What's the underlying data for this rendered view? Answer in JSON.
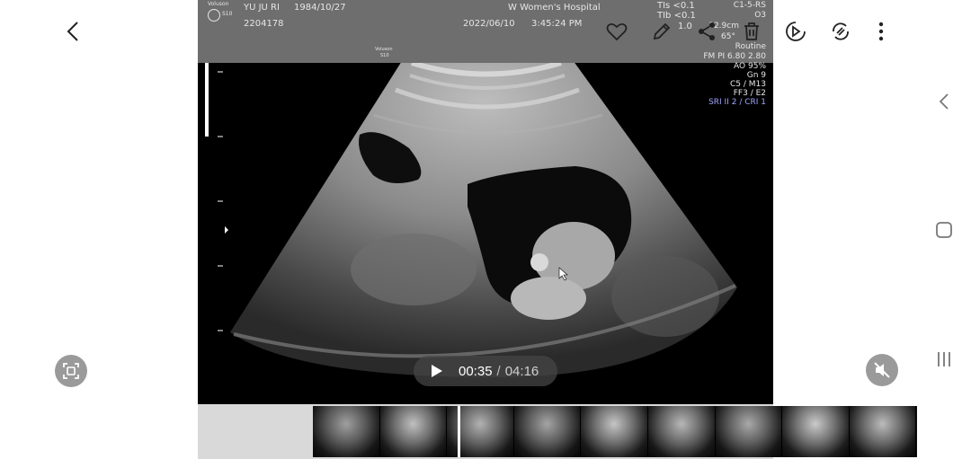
{
  "overlay": {
    "patient_name": "YU JU RI",
    "birth_date": "1984/10/27",
    "patient_id": "2204178",
    "hospital": "W Women's Hospital",
    "date": "2022/06/10",
    "time": "3:45:24 PM",
    "brand": "Voluson",
    "brand_model": "S10",
    "brand_logo": "GE",
    "tis_label": "TIs <0.1",
    "tib_label": "TIb <0.1",
    "mi_value": "1.0",
    "probe": "C1-5-RS",
    "preset": "O3",
    "depth": "12.9cm",
    "angle": "65°",
    "params": [
      "Routine",
      "FM PI 6.80    2.80",
      "AO 95%",
      "Gn  9",
      "C5 / M13",
      "FF3 / E2",
      "SRI II 2 / CRI 1"
    ]
  },
  "toolbar": {
    "back_icon": "chevron-left-icon",
    "favorite_icon": "heart-icon",
    "edit_icon": "pencil-icon",
    "share_icon": "share-icon",
    "delete_icon": "trash-icon",
    "video_player_icon": "play-circle-icon",
    "rotate_icon": "rotate-icon",
    "more_icon": "more-vertical-icon"
  },
  "player": {
    "current_time": "00:35",
    "separator": "/",
    "duration": "04:16"
  },
  "colors": {
    "accent_blue": "#9fa6ff",
    "header_gray": "#6e6e6e",
    "side_button_gray": "#9a9a9a"
  }
}
